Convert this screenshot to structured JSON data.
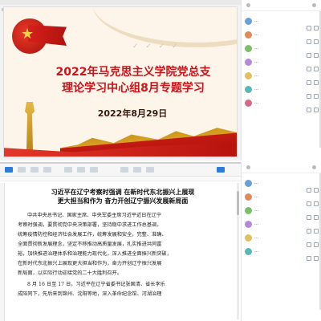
{
  "slide": {
    "title_line1": "2022年马克思主义学院党总支",
    "title_line2": "理论学习中心组8月专题学习",
    "date": "2022年8月29日"
  },
  "participants_top": [
    {
      "name": "…"
    },
    {
      "name": "…"
    },
    {
      "name": "…"
    },
    {
      "name": "…"
    },
    {
      "name": "…"
    },
    {
      "name": "…"
    },
    {
      "name": "…"
    }
  ],
  "participants_bottom": [
    {
      "name": "…"
    },
    {
      "name": "…"
    },
    {
      "name": "…"
    },
    {
      "name": "…"
    },
    {
      "name": "…"
    },
    {
      "name": "…"
    }
  ],
  "document": {
    "title_line1": "习近平在辽宁考察时强调 在新时代东北振兴上展现",
    "title_line2": "更大担当和作为 奋力开创辽宁振兴发展新局面",
    "para1": [
      "中共中央总书记、国家主席、中央军委主席习近平近日在辽宁",
      "考察时强调，要贯彻党中央决策部署，坚持稳中求进工作总基调，",
      "统筹疫情防控和经济社会发展工作，统筹发展和安全，完整、准确、",
      "全面贯彻新发展理念，坚定不移推动高质量发展，扎实推进共同富",
      "裕，加快推进治理体系和治理能力现代化，深入推进全面振兴新突破，",
      "在新时代东北振兴上展现更大担当和作为，奋力开创辽宁振兴发展",
      "新局面，以实际行动迎接党的二十大胜利召开。"
    ],
    "para2": [
      "8 月 16 日至 17 日，习近平在辽宁省委书记张国清、省长李乐",
      "成陪同下，先后来到锦州、沈阳等地，深入革命纪念馆、河湖治理"
    ]
  },
  "colors": {
    "slide_title": "#c8141a",
    "accent_blue": "#2f7bd9"
  }
}
